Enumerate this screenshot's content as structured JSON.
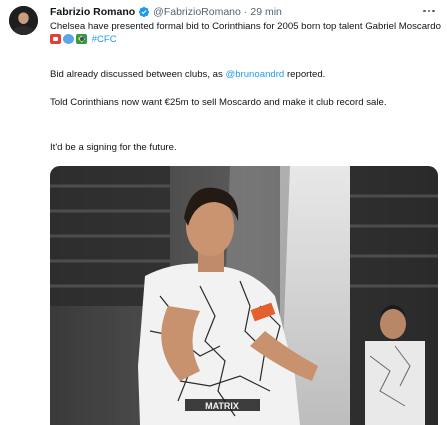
{
  "author": {
    "name": "Fabrizio Romano",
    "handle": "@FabrizioRomano",
    "separator": "·",
    "time": "29 min"
  },
  "icons": {
    "avatar": "profile-photo",
    "verified": "verified-badge-icon",
    "more": "more-options-icon",
    "flags": [
      "england-flag-emoji",
      "blue-circle-emoji",
      "brazil-flag-emoji"
    ]
  },
  "tweet": {
    "line1": "Chelsea have presented formal bid to Corinthians for 2005 born top talent Gabriel Moscardo",
    "hashtag": "#CFC",
    "line2_pre": "Bid already discussed between clubs, as ",
    "mention": "@brunoandrd",
    "line2_post": " reported.",
    "line3": "Told Corinthians now want €25m to sell Moscardo and make it club record sale.",
    "line4": "It'd be a signing for the future."
  },
  "media": {
    "sponsor_text": "MATRIX"
  },
  "colors": {
    "link": "#1d9bf0",
    "secondary_text": "#536471",
    "verified": "#1d9bf0"
  }
}
